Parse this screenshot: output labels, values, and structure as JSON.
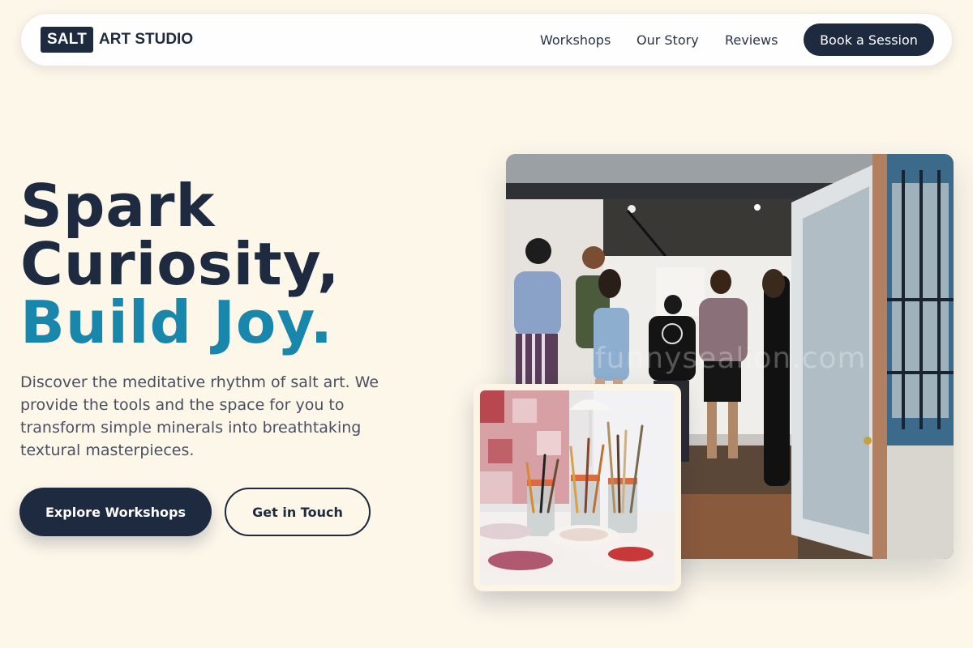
{
  "brand": {
    "badge": "SALT",
    "name": "ART STUDIO"
  },
  "nav": {
    "links": [
      "Workshops",
      "Our Story",
      "Reviews"
    ],
    "cta": "Book a Session"
  },
  "hero": {
    "title_line1": "Spark",
    "title_line2": "Curiosity,",
    "title_accent": "Build Joy.",
    "description": "Discover the meditative rhythm of salt art. We provide the tools and the space for you to transform simple minerals into breathtaking textural masterpieces.",
    "primary_button": "Explore Workshops",
    "secondary_button": "Get in Touch"
  },
  "images": {
    "main_watermark": "funnysealion.com"
  },
  "colors": {
    "navy": "#1e2a3f",
    "accent": "#1987ab",
    "background": "#fdf7ea"
  }
}
